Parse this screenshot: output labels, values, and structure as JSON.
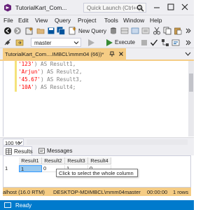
{
  "window": {
    "title": "TutorialKart_Com...",
    "quick_launch_placeholder": "Quick Launch (Ctrl+Q)"
  },
  "menu": [
    "File",
    "Edit",
    "View",
    "Query",
    "Project",
    "Tools",
    "Window",
    "Help"
  ],
  "toolbar": {
    "new_query_label": "New Query",
    "database": "master",
    "execute_label": "Execute"
  },
  "document_tab": {
    "title": "TutorialKart_Com....IMBCL\\mmm04 (66))*"
  },
  "editor": {
    "lines": [
      {
        "str": "'123'",
        "rest": ") AS Result1,"
      },
      {
        "str": "'Arjun'",
        "rest": ") AS Result2,"
      },
      {
        "str": "'45.67'",
        "rest": ") AS Result3,"
      },
      {
        "str": "'10A'",
        "rest": ") AS Result4;"
      }
    ]
  },
  "zoom": "100 %",
  "result_tabs": {
    "results": "Results",
    "messages": "Messages"
  },
  "grid": {
    "headers": [
      "Result1",
      "Result2",
      "Result3",
      "Result4"
    ],
    "row_number": "1",
    "row": [
      "1",
      "0",
      "1",
      "0"
    ],
    "tooltip": "Click to select the whole column"
  },
  "status": {
    "server": "alhost (16.0 RTM)",
    "host": "DESKTOP-MDIMBCL\\mmm04 ...",
    "database": "master",
    "elapsed": "00:00:00",
    "rows": "1 rows"
  },
  "app_status": "Ready",
  "colors": {
    "accent": "#007acc",
    "tab_active": "#f5cc84",
    "string": "#ff0000",
    "keyword": "#0000ff"
  }
}
